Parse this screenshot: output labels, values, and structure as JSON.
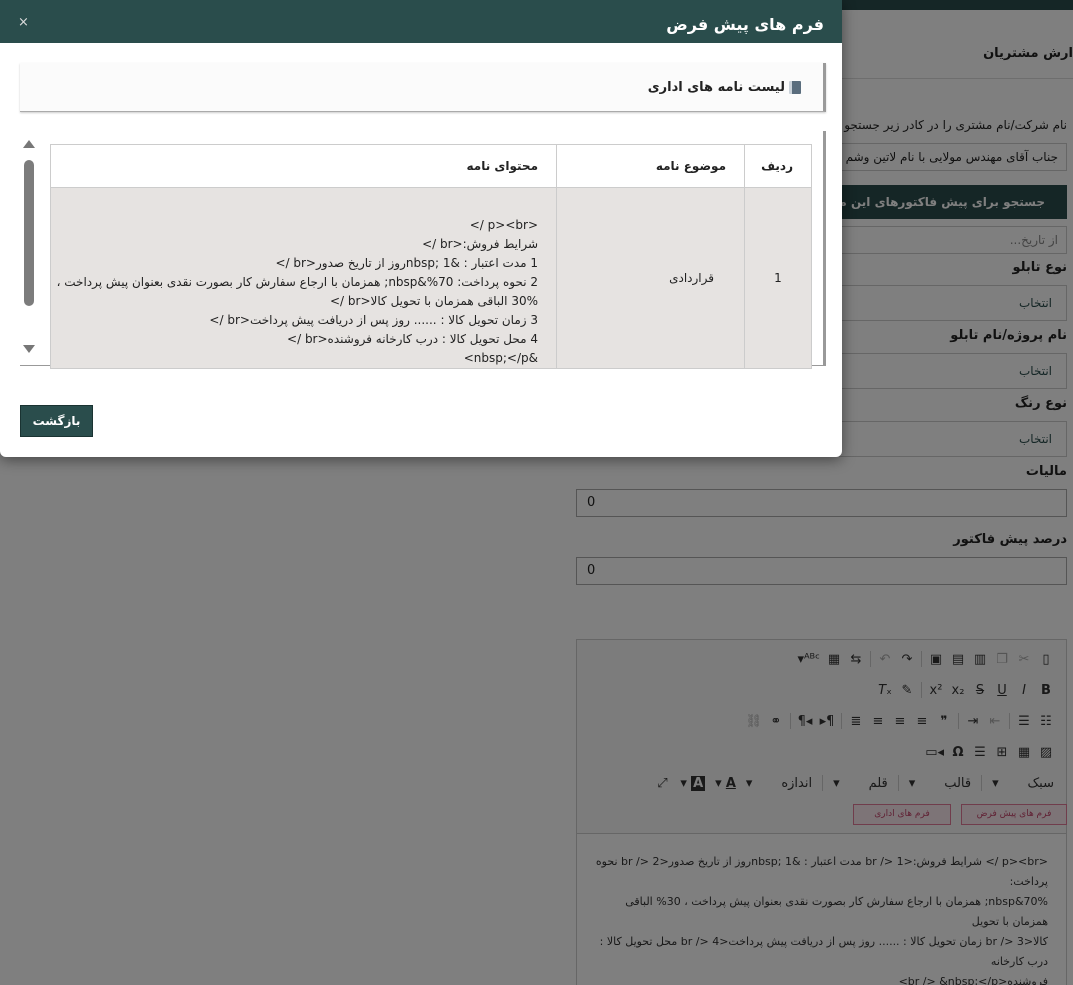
{
  "modal": {
    "title": "فرم های پیش فرض",
    "close_glyph": "×",
    "panel_title": "لیست نامه های اداری",
    "table": {
      "headers": [
        "ردیف",
        "موضوع نامه",
        "محتوای نامه"
      ],
      "rows": [
        {
          "num": "1",
          "subject": "قراردادی",
          "content_lines": [
            "<p><br />",
            "شرایط فروش:<br />",
            "1 مدت اعتبار : &nbsp; 1روز از تاریخ صدور<br />",
            "2 نحوه پرداخت: 70%&nbsp; همزمان با ارجاع سفارش کار بصورت نقدی بعنوان پیش پرداخت ،",
            "30% الباقی همزمان با تحویل کالا<br />",
            "3 زمان تحویل کالا : ...... روز پس از دریافت پیش پرداخت<br />",
            "4 محل تحویل کالا : درب کارخانه فروشنده<br />",
            "&nbsp;</p>"
          ]
        }
      ]
    },
    "back_label": "بازگشت"
  },
  "background": {
    "heading": "ارش مشتریان",
    "search_hint": "نام شرکت/نام مشتری را در کادر زیر جستجو",
    "customer_value": "جناب آقای مهندس مولایی  با نام لاتین  وشم",
    "search_invoices_btn": "جستجو برای پیش فاکتورهای این مشتری",
    "date_placeholder": "از تاریخ...",
    "fields": [
      {
        "label": "نوع تابلو",
        "value": "انتخاب"
      },
      {
        "label": "نام پروژه/نام تابلو",
        "value": "انتخاب"
      },
      {
        "label": "نوع رنگ",
        "value": "انتخاب"
      }
    ],
    "tax_label": "مالیات",
    "tax_value": "0",
    "percent_label": "درصد پیش فاکتور",
    "percent_value": "0",
    "editor": {
      "combos": {
        "style": "سبک",
        "format": "قالب",
        "font": "قلم",
        "size": "اندازه"
      },
      "template_buttons": [
        "فرم های پیش فرض",
        "فرم های اداری"
      ],
      "content_lines": [
        "<p><br /> شرایط فروش:<br /> 1 مدت اعتبار : &nbsp; 1روز از تاریخ صدور<br /> 2 نحوه پرداخت:",
        "70%&nbsp; همزمان با ارجاع سفارش کار بصورت نقدی بعنوان پیش پرداخت ، 30% الباقی همزمان با تحویل",
        "کالا<br /> 3 زمان تحویل کالا : ...... روز پس از دریافت پیش پرداخت<br /> 4 محل تحویل کالا : درب کارخانه",
        "فروشنده<br /> &nbsp;</p>"
      ]
    }
  }
}
